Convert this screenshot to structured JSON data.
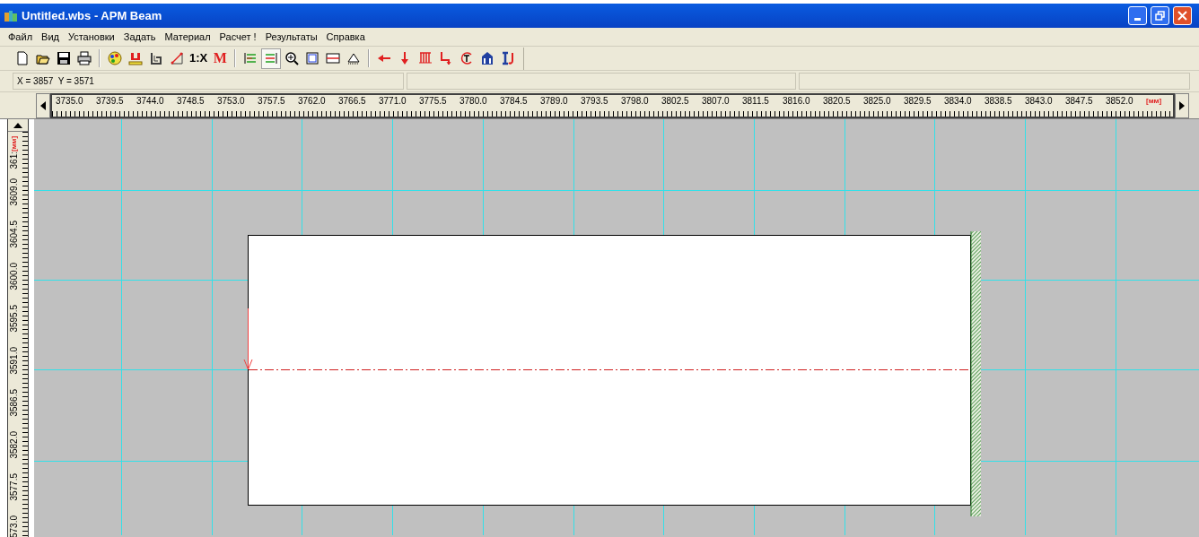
{
  "window": {
    "title": "Untitled.wbs - APM Beam"
  },
  "menu": [
    "Файл",
    "Вид",
    "Установки",
    "Задать",
    "Материал",
    "Расчет !",
    "Результаты",
    "Справка"
  ],
  "toolbar": [
    {
      "kind": "new",
      "pressed": false
    },
    {
      "kind": "open",
      "pressed": false
    },
    {
      "kind": "save",
      "pressed": false
    },
    {
      "kind": "print",
      "pressed": false
    },
    {
      "kind": "separator"
    },
    {
      "kind": "palette",
      "pressed": false
    },
    {
      "kind": "magnet",
      "pressed": false
    },
    {
      "kind": "g",
      "pressed": false
    },
    {
      "kind": "skew",
      "pressed": false
    },
    {
      "kind": "text",
      "label": "1:X",
      "pressed": false
    },
    {
      "kind": "text-red",
      "label": "M",
      "pressed": false
    },
    {
      "kind": "separator"
    },
    {
      "kind": "lines-green",
      "pressed": false
    },
    {
      "kind": "lines-red",
      "pressed": true
    },
    {
      "kind": "zoom",
      "pressed": false
    },
    {
      "kind": "square",
      "pressed": false
    },
    {
      "kind": "section",
      "pressed": false
    },
    {
      "kind": "support",
      "pressed": false
    },
    {
      "kind": "separator"
    },
    {
      "kind": "arrow-left",
      "pressed": false
    },
    {
      "kind": "arrow-down",
      "pressed": false
    },
    {
      "kind": "dist-load",
      "pressed": false
    },
    {
      "kind": "step",
      "pressed": false
    },
    {
      "kind": "torque",
      "pressed": false
    },
    {
      "kind": "building",
      "pressed": false
    },
    {
      "kind": "profile",
      "pressed": false
    }
  ],
  "coordinates": "X = 3857  Y = 3571",
  "ruler_x": {
    "labels": [
      "3735.0",
      "3739.5",
      "3744.0",
      "3748.5",
      "3753.0",
      "3757.5",
      "3762.0",
      "3766.5",
      "3771.0",
      "3775.5",
      "3780.0",
      "3784.5",
      "3789.0",
      "3793.5",
      "3798.0",
      "3802.5",
      "3807.0",
      "3811.5",
      "3816.0",
      "3820.5",
      "3825.0",
      "3829.5",
      "3834.0",
      "3838.5",
      "3843.0",
      "3847.5",
      "3852.0"
    ],
    "unit": "[мм]"
  },
  "ruler_y": {
    "unit": "[мм]",
    "labels": [
      "361:",
      "3609.0",
      "3604.5",
      "3600.0",
      "3595.5",
      "3591.0",
      "3586.5",
      "3582.0",
      "3577.5",
      "573.0"
    ]
  }
}
